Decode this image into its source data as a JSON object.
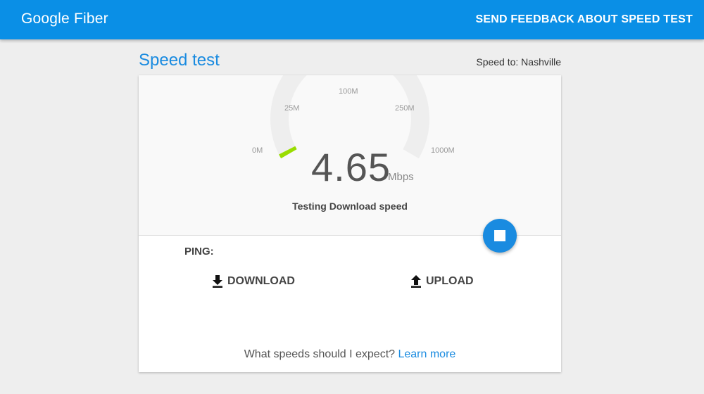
{
  "header": {
    "logo": "Google Fiber",
    "feedback_label": "SEND FEEDBACK ABOUT SPEED TEST"
  },
  "page": {
    "title": "Speed test",
    "speed_to": "Speed to: Nashville"
  },
  "gauge": {
    "ticks": [
      "0M",
      "25M",
      "100M",
      "250M",
      "1000M"
    ],
    "value": "4.65",
    "unit": "Mbps",
    "status": "Testing Download speed",
    "arc_color": "#eeeeee",
    "progress_color": "#99dd00"
  },
  "results": {
    "ping_label": "PING:",
    "download_label": "DOWNLOAD",
    "upload_label": "UPLOAD"
  },
  "footer": {
    "question": "What speeds should I expect? ",
    "link": "Learn more"
  },
  "colors": {
    "brand": "#0a8fe6",
    "accent": "#1a8be0"
  }
}
